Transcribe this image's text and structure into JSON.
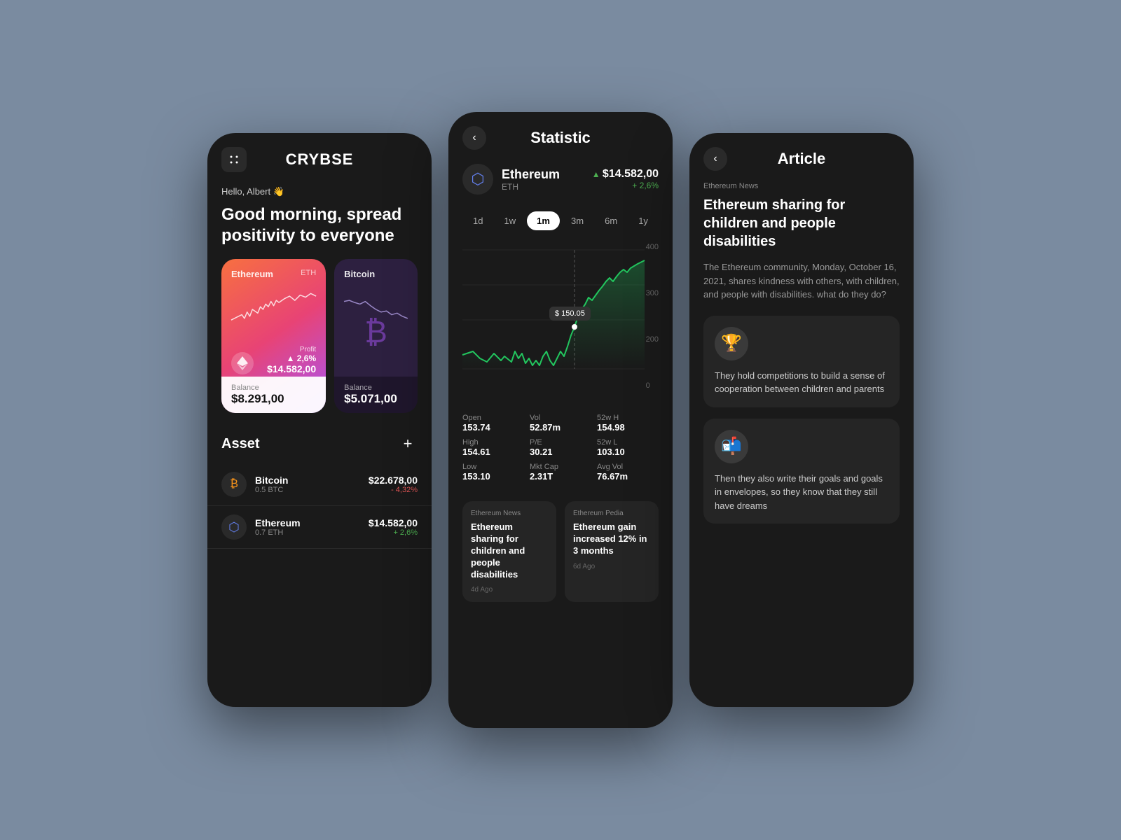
{
  "background": "#7a8ba0",
  "phone1": {
    "logo": "CRYBSE",
    "greeting": "Hello, Albert 👋",
    "morning": "Good morning, spread positivity to everyone",
    "eth_card": {
      "label": "Ethereum",
      "ticker": "ETH",
      "profit_label": "Profit",
      "profit_pct": "▲ 2,6%",
      "profit_val": "$14.582,00",
      "balance_label": "Balance",
      "balance_val": "$8.291,00"
    },
    "btc_card": {
      "label": "Bitcoin",
      "balance_label": "Balance",
      "balance_val": "$5.071,00"
    },
    "asset_title": "Asset",
    "assets": [
      {
        "name": "Bitcoin",
        "sub": "0.5 BTC",
        "price": "$22.678,00",
        "change": "- 4,32%",
        "change_type": "neg",
        "icon": "₿"
      },
      {
        "name": "Ethereum",
        "sub": "0.7 ETH",
        "price": "$14.582,00",
        "change": "+ 2,6%",
        "change_type": "pos",
        "icon": "⬡"
      }
    ]
  },
  "phone2": {
    "title": "Statistic",
    "coin": {
      "name": "Ethereum",
      "ticker": "ETH",
      "price": "$14.582,00",
      "change": "+ 2,6%",
      "icon": "⬡"
    },
    "periods": [
      "1d",
      "1w",
      "1m",
      "3m",
      "6m",
      "1y"
    ],
    "active_period": "1m",
    "chart_y_labels": [
      "400",
      "300",
      "200",
      "0"
    ],
    "tooltip_val": "$ 150.05",
    "stats": [
      {
        "label": "Open",
        "val": "153.74"
      },
      {
        "label": "Vol",
        "val": "52.87m"
      },
      {
        "label": "52w H",
        "val": "154.98"
      },
      {
        "label": "High",
        "val": "154.61"
      },
      {
        "label": "P/E",
        "val": "30.21"
      },
      {
        "label": "52w L",
        "val": "103.10"
      },
      {
        "label": "Low",
        "val": "153.10"
      },
      {
        "label": "Mkt Cap",
        "val": "2.31T"
      },
      {
        "label": "Avg Vol",
        "val": "76.67m"
      }
    ],
    "news": [
      {
        "source": "Ethereum News",
        "title": "Ethereum sharing for children and people disabilities",
        "time": "4d Ago"
      },
      {
        "source": "Ethereum Pedia",
        "title": "Ethereum gain increased 12% in 3 months",
        "time": "6d Ago"
      }
    ]
  },
  "phone3": {
    "title": "Article",
    "source": "Ethereum News",
    "headline": "Ethereum sharing for children and people disabilities",
    "desc": "The Ethereum community, Monday, October 16, 2021, shares kindness with others, with children, and people with disabilities. what do they do?",
    "articles": [
      {
        "icon": "🏆",
        "text": "They hold competitions to build a sense of cooperation between children and parents"
      },
      {
        "icon": "📬",
        "text": "Then they also write their goals and goals in envelopes, so they know that they still have dreams"
      }
    ]
  },
  "icons": {
    "menu": "⠿",
    "back": "‹",
    "plus": "+",
    "arrow_up": "▲"
  }
}
